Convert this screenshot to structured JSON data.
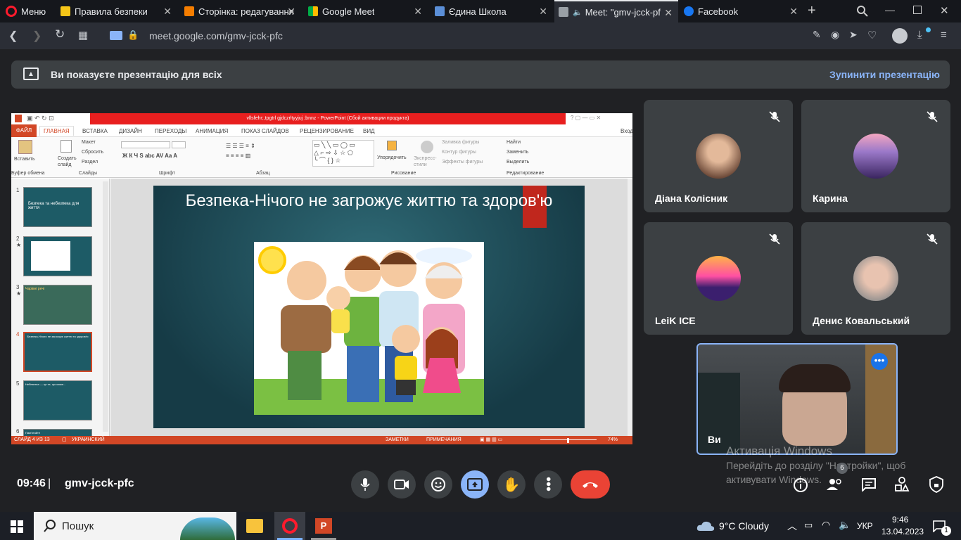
{
  "browser": {
    "menu_label": "Меню",
    "tabs": [
      {
        "label": "Правила безпеки",
        "icon": "bookmark-icon",
        "color": "#f5c518"
      },
      {
        "label": "Сторінка: редагування",
        "icon": "blogger-icon",
        "color": "#f57d00"
      },
      {
        "label": "Google Meet",
        "icon": "meet-icon",
        "color": "#00ac47"
      },
      {
        "label": "Єдина Школа",
        "icon": "school-icon",
        "color": "#5b8fd8"
      },
      {
        "label": "Meet: \"gmv-jcck-pf",
        "icon": "meet-icon",
        "color": "#00ac47"
      },
      {
        "label": "Facebook",
        "icon": "facebook-icon",
        "color": "#1877f2"
      }
    ],
    "url": "meet.google.com/gmv-jcck-pfc"
  },
  "meet": {
    "banner_text": "Ви показуєте презентацію для всіх",
    "stop_label": "Зупинити презентацію",
    "time": "09:46",
    "meeting_code": "gmv-jcck-pfc",
    "participants_badge": "6",
    "participants": [
      {
        "name": "Діана Колісник",
        "avatar": "photo"
      },
      {
        "name": "Карина",
        "avatar": "photo"
      },
      {
        "name": "LeiK ICE",
        "avatar": "logo"
      },
      {
        "name": "Денис Ковальський",
        "avatar": "photo"
      }
    ],
    "self_label": "Ви",
    "watermark_title": "Активація Windows",
    "watermark_line1": "Перейдіть до розділу \"Настройки\", щоб",
    "watermark_line2": "активувати Windows."
  },
  "ppt": {
    "window_title": "vllsfehr;,tpgtrl gjdczrltyyjuj ;bnnz - PowerPoint (Сбой активации продукта)",
    "tabs": [
      "ФАЙЛ",
      "ГЛАВНАЯ",
      "ВСТАВКА",
      "ДИЗАЙН",
      "ПЕРЕХОДЫ",
      "АНИМАЦИЯ",
      "ПОКАЗ СЛАЙДОВ",
      "РЕЦЕНЗИРОВАНИЕ",
      "ВИД"
    ],
    "signin": "Вход",
    "groups": [
      "Буфер обмена",
      "Слайды",
      "Шрифт",
      "Абзац",
      "Рисование",
      "Редактирование"
    ],
    "paste": "Вставить",
    "create_slide": "Создать слайд",
    "layout": "Макет",
    "reset": "Сбросить",
    "section": "Раздел",
    "arrange": "Упорядочить",
    "express": "Экспресс-стили",
    "fill": "Заливка фигуры",
    "outline": "Контур фигуры",
    "effects": "Эффекты фигуры",
    "find": "Найти",
    "replace": "Заменить",
    "select": "Выделить",
    "slide_title": "Безпека-Нічого не загрожує життю та здоров'ю",
    "slides": [
      {
        "num": "1",
        "star": "",
        "title": "Безпека та небезпека для життя"
      },
      {
        "num": "2",
        "star": "★",
        "title": ""
      },
      {
        "num": "3",
        "star": "★",
        "title": "Чарівні речі"
      },
      {
        "num": "4",
        "star": "",
        "title": "Безпека-Нічого не загрожує життю та здоров'ю"
      },
      {
        "num": "5",
        "star": "",
        "title": "Небезпека — це те, що може..."
      },
      {
        "num": "6",
        "star": "",
        "title": "Пам'ятайте"
      }
    ],
    "status_slide": "СЛАЙД 4 ИЗ 13",
    "status_lang": "УКРАИНСКИЙ",
    "notes": "ЗАМЕТКИ",
    "comments": "ПРИМЕЧАНИЯ",
    "zoom": "74%"
  },
  "taskbar": {
    "search_placeholder": "Пошук",
    "weather": "9°C  Cloudy",
    "lang": "УКР",
    "time": "9:46",
    "date": "13.04.2023",
    "notif": "1"
  }
}
